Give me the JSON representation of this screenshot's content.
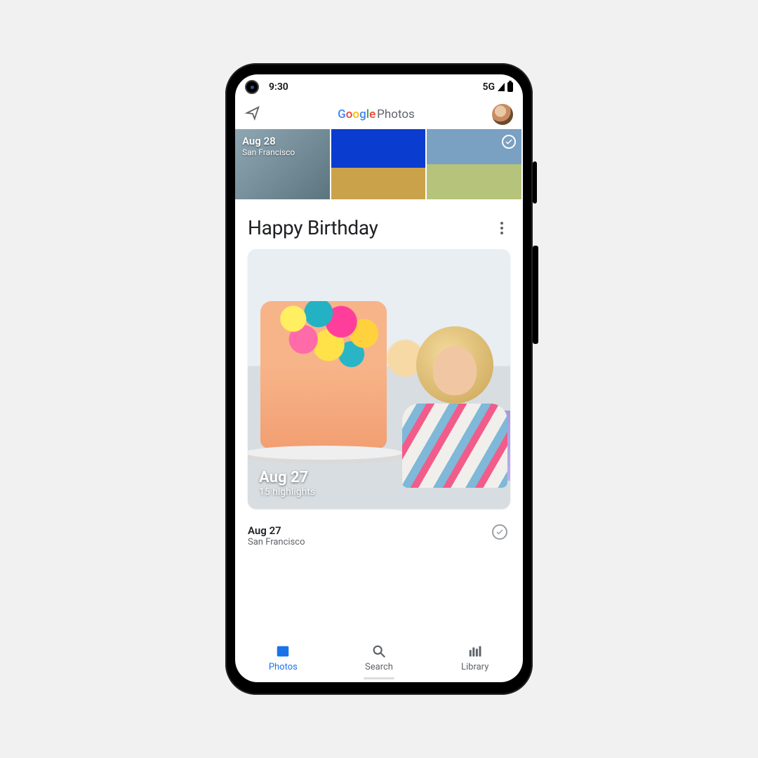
{
  "status": {
    "time": "9:30",
    "network": "5G"
  },
  "appbar": {
    "logo_word": "Google",
    "logo_suffix": "Photos"
  },
  "strip": {
    "date": "Aug 28",
    "location": "San Francisco"
  },
  "memory": {
    "title": "Happy Birthday",
    "date": "Aug 27",
    "highlights": "15 highlights"
  },
  "day": {
    "date": "Aug 27",
    "location": "San Francisco"
  },
  "nav": {
    "photos": "Photos",
    "search": "Search",
    "library": "Library"
  }
}
